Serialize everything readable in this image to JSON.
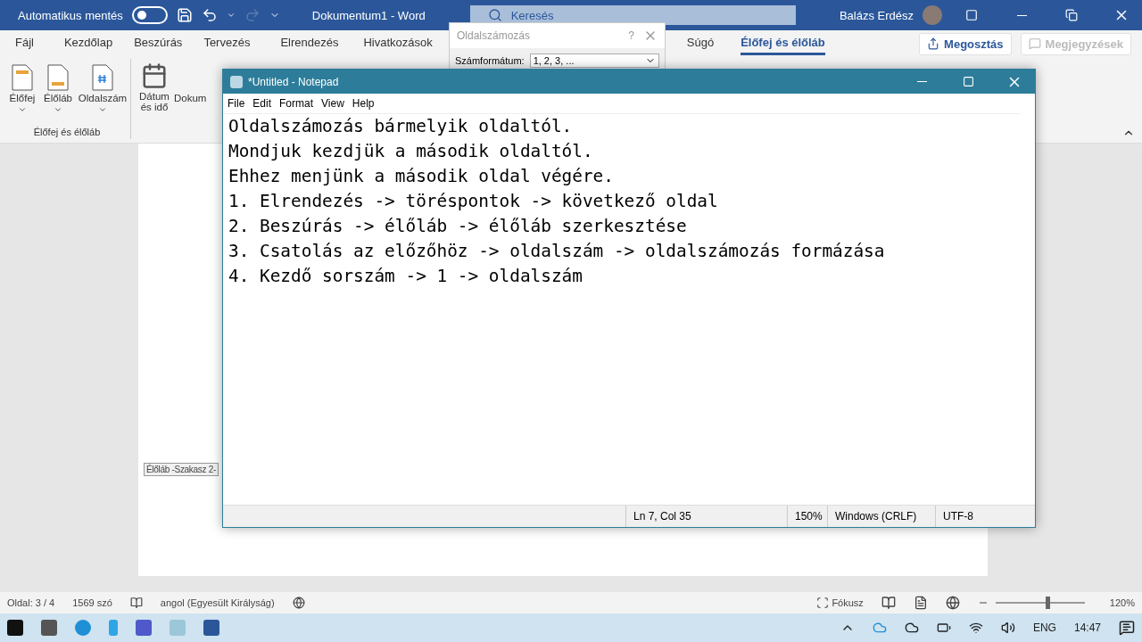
{
  "word": {
    "autosave": {
      "label": "Automatikus mentés",
      "on": false
    },
    "title": "Dokumentum1  -  Word",
    "search": {
      "placeholder": "Keresés"
    },
    "user": "Balázs Erdész",
    "tabs": [
      {
        "label": "Fájl",
        "selected": false
      },
      {
        "label": "Kezdőlap",
        "selected": false
      },
      {
        "label": "Beszúrás",
        "selected": false
      },
      {
        "label": "Tervezés",
        "selected": false
      },
      {
        "label": "Elrendezés",
        "selected": false
      },
      {
        "label": "Hivatkozások",
        "selected": false
      },
      {
        "label": "Súgó",
        "selected": false
      },
      {
        "label": "Élőfej és élőláb",
        "selected": true
      }
    ],
    "share": "Megosztás",
    "comments": "Megjegyzések",
    "ribbon": {
      "group_label": "Élőfej és élőláb",
      "buttons": [
        {
          "kind": "header",
          "label": "Élőfej"
        },
        {
          "kind": "footer",
          "label": "Élőláb"
        },
        {
          "kind": "pagenum",
          "label": "Oldalszám"
        }
      ],
      "date": "Dátum\nés idő",
      "cut_button": "Dokum"
    },
    "footer_tag": "Élőláb -Szakasz 2-",
    "status": {
      "page": "Oldal: 3 / 4",
      "words": "1569 szó",
      "language": "angol (Egyesült Királyság)",
      "focus": "Fókusz",
      "zoom": {
        "level": 0.58,
        "reading": "120%"
      }
    }
  },
  "dialog": {
    "title": "Oldalszámozás",
    "help": "?",
    "field_label": "Számformátum:",
    "field_value": "1, 2, 3, ..."
  },
  "notepad": {
    "title": "*Untitled - Notepad",
    "menu": [
      "File",
      "Edit",
      "Format",
      "View",
      "Help"
    ],
    "lines": [
      "Oldalszámozás bármelyik oldaltól.",
      "Mondjuk kezdjük a második oldaltól.",
      "Ehhez menjünk a második oldal végére.",
      "1. Elrendezés -> töréspontok -> következő oldal",
      "2. Beszúrás -> élőláb -> élőláb szerkesztése",
      "3. Csatolás az előzőhöz -> oldalszám -> oldalszámozás formázása",
      "4. Kezdő sorszám -> 1 -> oldalszám"
    ],
    "status": [
      "Ln 7, Col 35",
      "150%",
      "Windows (CRLF)",
      "UTF-8"
    ]
  },
  "taskbar": {
    "language": "ENG",
    "time": "14:47"
  }
}
